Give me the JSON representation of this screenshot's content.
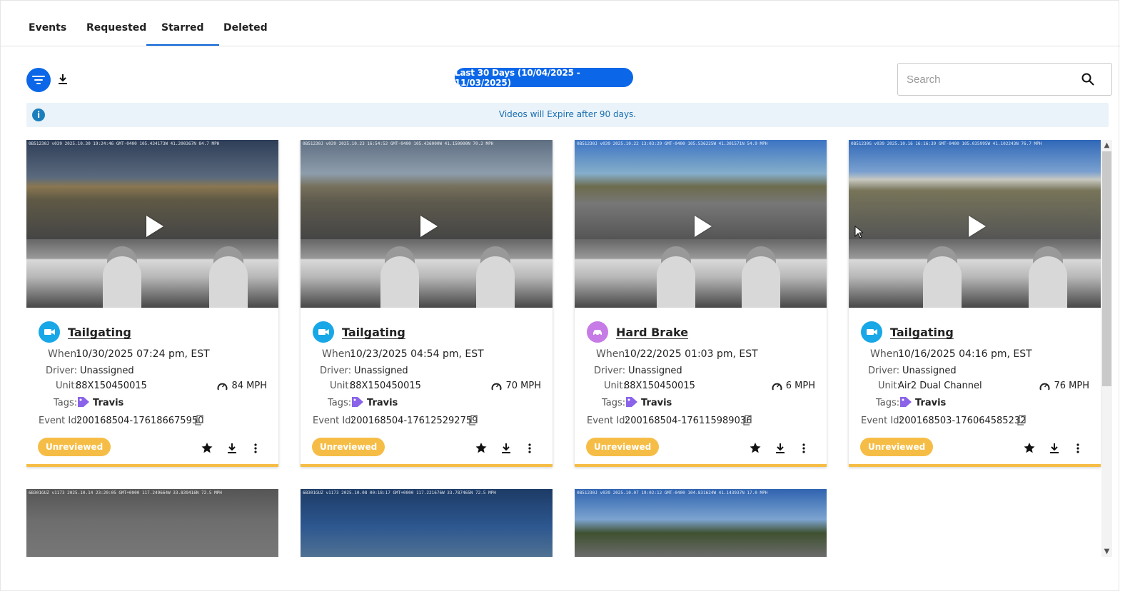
{
  "tabs": [
    {
      "label": "Events",
      "active": false
    },
    {
      "label": "Requested",
      "active": false
    },
    {
      "label": "Starred",
      "active": true
    },
    {
      "label": "Deleted",
      "active": false
    }
  ],
  "toolbar": {
    "date_range": "Last 30 Days (10/04/2025 - 11/03/2025)",
    "filter_icon": "filter-icon",
    "download_icon": "download-icon"
  },
  "search": {
    "placeholder": "Search",
    "value": ""
  },
  "notice": {
    "text": "Videos will Expire after 90 days.",
    "icon": "info-icon"
  },
  "labels": {
    "when": "When:",
    "driver": "Driver:",
    "unit": "Unit:",
    "tags": "Tags:",
    "event_id": "Event Id:"
  },
  "cards": [
    {
      "type": "Tailgating",
      "icon": "camera-icon",
      "icon_color": "#18a7e7",
      "when": "10/30/2025 07:24 pm, EST",
      "driver": "Unassigned",
      "unit": "88X150450015",
      "speed": "84 MPH",
      "tag": "Travis",
      "event_id": "200168504-176186675950",
      "status": "Unreviewed",
      "video_overlay": "0B51230J v039 2025.10.30 19:24:46 GMT-0400 105.434173W 41.200367N 84.7 MPH"
    },
    {
      "type": "Tailgating",
      "icon": "camera-icon",
      "icon_color": "#18a7e7",
      "when": "10/23/2025 04:54 pm, EST",
      "driver": "Unassigned",
      "unit": "88X150450015",
      "speed": "70 MPH",
      "tag": "Travis",
      "event_id": "200168504-176125292759",
      "status": "Unreviewed",
      "video_overlay": "0B51230J v039 2025.10.23 16:54:52 GMT-0400 105.436000W 41.150000N 70.2 MPH"
    },
    {
      "type": "Hard Brake",
      "icon": "car-brake-icon",
      "icon_color": "#c77be6",
      "when": "10/22/2025 01:03 pm, EST",
      "driver": "Unassigned",
      "unit": "88X150450015",
      "speed": "6 MPH",
      "tag": "Travis",
      "event_id": "200168504-176115989036",
      "status": "Unreviewed",
      "video_overlay": "0B51230J v039 2025.10.22 13:03:29 GMT-0400 105.536225W 41.301571N 54.9 MPH"
    },
    {
      "type": "Tailgating",
      "icon": "camera-icon",
      "icon_color": "#18a7e7",
      "when": "10/16/2025 04:16 pm, EST",
      "driver": "Unassigned",
      "unit": "Air2 Dual Channel",
      "speed": "76 MPH",
      "tag": "Travis",
      "event_id": "200168503-176064585232",
      "status": "Unreviewed",
      "video_overlay": "0B51230G v039 2025.10.16 16:16:39 GMT-0400 105.035995W 41.102243N 76.7 MPH"
    }
  ],
  "preview_rows": [
    {
      "video_overlay": "6B301GUZ v1173 2025.10.14 23:20:05 GMT+0000 117.249664W 33.839416N 72.5 MPH"
    },
    {
      "video_overlay": "6B301GUZ v1173 2025.10.08 00:18:17 GMT+0000 117.221676W 33.787465N 72.5 MPH"
    },
    {
      "video_overlay": "0B51230J v039 2025.10.07 19:02:12 GMT-0400 104.831624W 41.143937N 17.0 MPH"
    }
  ]
}
